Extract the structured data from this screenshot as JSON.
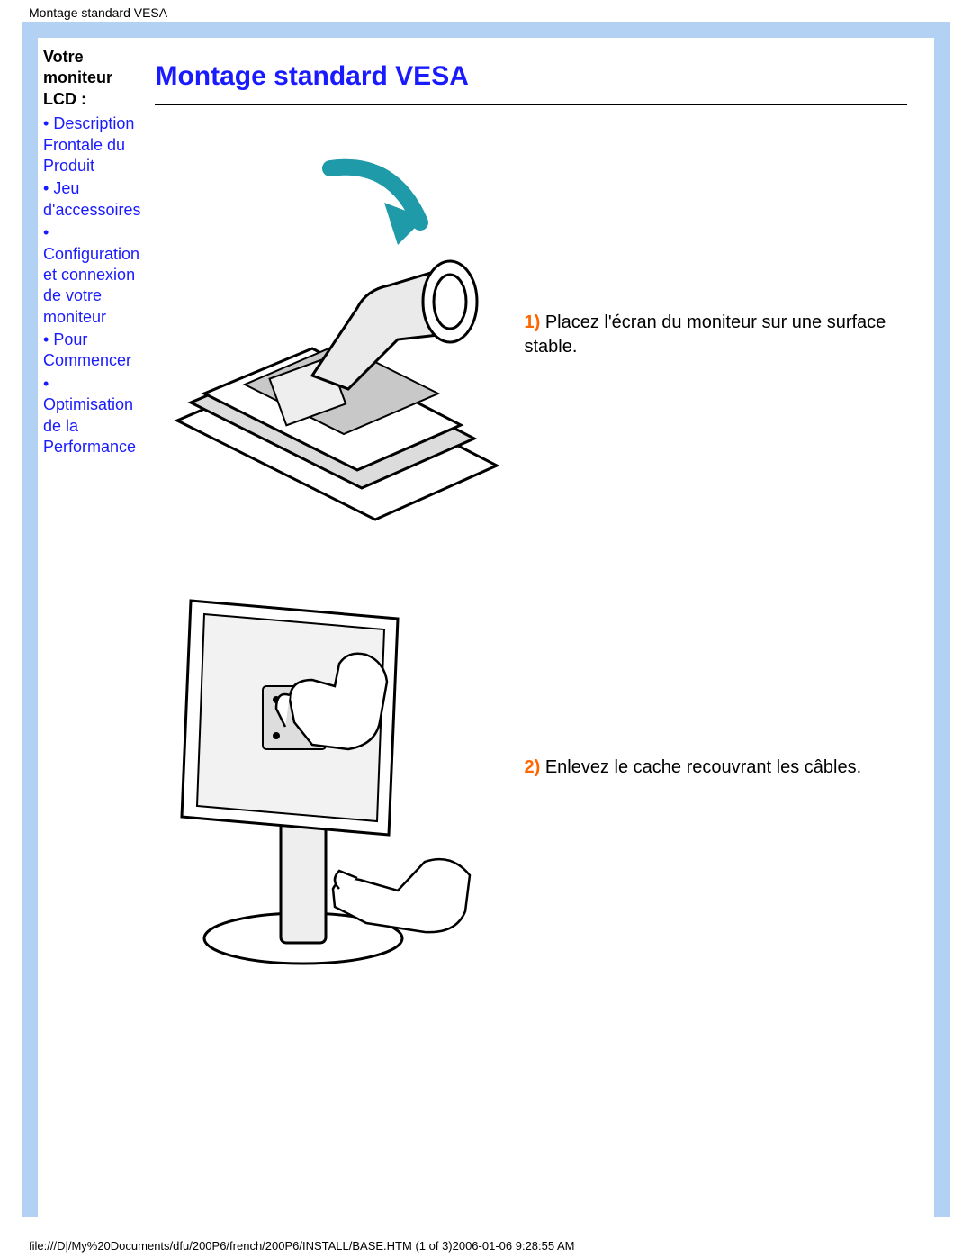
{
  "header": {
    "title": "Montage standard VESA"
  },
  "sidebar": {
    "heading_line1": "Votre",
    "heading_line2": "moniteur",
    "heading_line3": "LCD :",
    "items": [
      {
        "label": "Description Frontale du Produit"
      },
      {
        "label": "Jeu d'accessoires"
      },
      {
        "label": "Configuration et connexion de votre moniteur"
      },
      {
        "label": "Pour Commencer"
      },
      {
        "label": "Optimisation de la Performance"
      }
    ]
  },
  "main": {
    "title": "Montage standard VESA",
    "steps": [
      {
        "num": "1)",
        "text": " Placez l'écran du moniteur sur une surface stable."
      },
      {
        "num": "2)",
        "text": " Enlevez le cache recouvrant les câbles."
      }
    ]
  },
  "footer": {
    "text": "file:///D|/My%20Documents/dfu/200P6/french/200P6/INSTALL/BASE.HTM (1 of 3)2006-01-06 9:28:55 AM"
  }
}
